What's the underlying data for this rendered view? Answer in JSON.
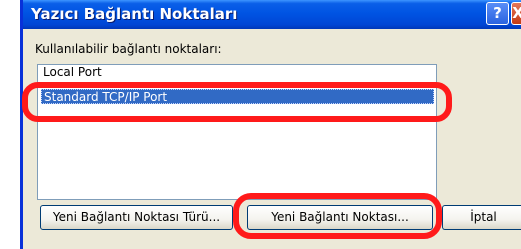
{
  "window": {
    "title": "Yazıcı Bağlantı Noktaları",
    "help_label": "?",
    "close_label": "X"
  },
  "ports": {
    "label": "Kullanılabilir bağlantı noktaları:",
    "items": [
      {
        "label": "Local Port",
        "selected": false
      },
      {
        "label": "Standard TCP/IP Port",
        "selected": true
      }
    ]
  },
  "buttons": {
    "new_port_type": "Yeni Bağlantı Noktası Türü...",
    "new_port": "Yeni Bağlantı Noktası...",
    "cancel": "İptal"
  },
  "colors": {
    "highlight": "#ff1a1a",
    "selection": "#316ac5",
    "titlebar": "#0054e3"
  }
}
